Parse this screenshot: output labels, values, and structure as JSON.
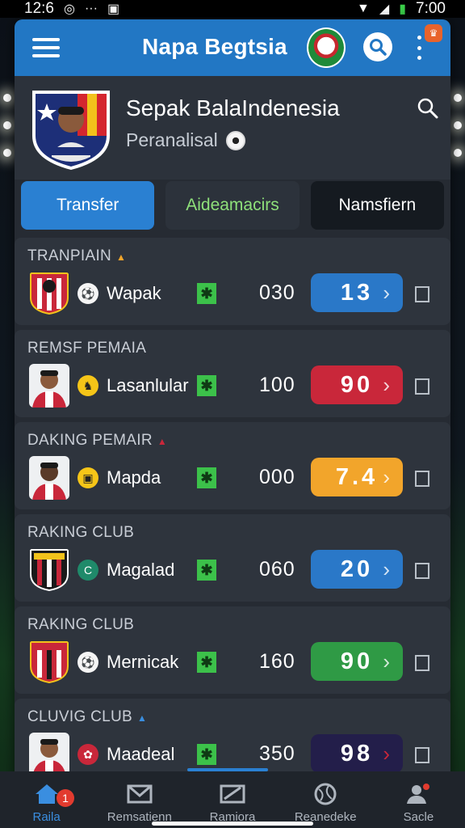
{
  "status_bar": {
    "time": "12:6",
    "battery_time": "7:00",
    "dots": "···"
  },
  "app_bar": {
    "title": "Napa Begtsia"
  },
  "header": {
    "title": "Sepak BalaIndenesia",
    "subtitle": "Peranalisal"
  },
  "tabs": [
    {
      "label": "Transfer"
    },
    {
      "label": "Aideamacirs"
    },
    {
      "label": "Namsfiern"
    }
  ],
  "rows": [
    {
      "section": "TRANPIAIN",
      "name": "Wapak",
      "number": "030",
      "score": "13",
      "score_color": "#2a78c8"
    },
    {
      "section": "REMSF PEMAIA",
      "name": "Lasanlular",
      "number": "100",
      "score": "90",
      "score_color": "#c9273a"
    },
    {
      "section": "DAKING PEMAIR",
      "name": "Mapda",
      "number": "000",
      "score": "7.4",
      "score_color": "#f2a52b"
    },
    {
      "section": "RAKING CLUB",
      "name": "Magalad",
      "number": "060",
      "score": "20",
      "score_color": "#2a78c8"
    },
    {
      "section": "RAKING CLUB",
      "name": "Mernicak",
      "number": "160",
      "score": "90",
      "score_color": "#2f9a45"
    },
    {
      "section": "CLUVIG CLUB",
      "name": "Maadeal",
      "number": "350",
      "score": "98",
      "score_color": "#231e4a"
    }
  ],
  "bottom_nav": [
    {
      "label": "Raila",
      "badge": "1"
    },
    {
      "label": "Remsatienn"
    },
    {
      "label": "Ramiora"
    },
    {
      "label": "Reanedeke"
    },
    {
      "label": "Sacle"
    }
  ],
  "colors": {
    "primary": "#2277c4",
    "tab_active": "#2a80d2",
    "tab_mid_text": "#8ee07a"
  }
}
